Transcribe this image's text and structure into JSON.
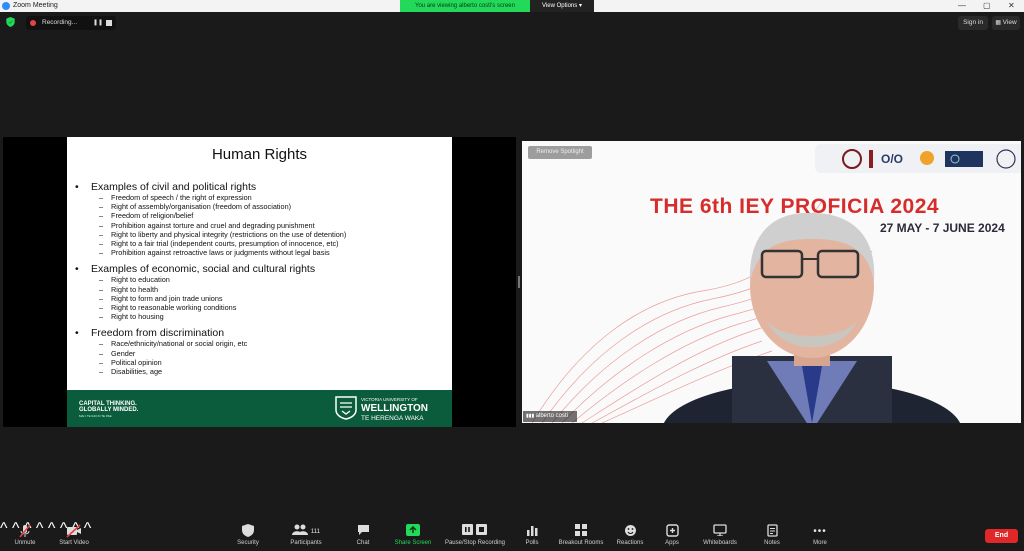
{
  "window": {
    "title": "Zoom Meeting",
    "controls": [
      "—",
      "▢",
      "✕"
    ]
  },
  "banner": {
    "share_text": "You are viewing alberto costi's screen",
    "view_options": "View Options"
  },
  "recording": {
    "label": "Recording..."
  },
  "top_right": {
    "sign_in": "Sign in",
    "view": "View"
  },
  "slide": {
    "title": "Human Rights",
    "sections": [
      {
        "heading": "Examples of civil and political rights",
        "items": [
          "Freedom of speech / the right of expression",
          "Right of assembly/organisation (freedom of association)",
          "Freedom of religion/belief",
          "Prohibition against torture and cruel and degrading punishment",
          "Right to liberty and physical integrity (restrictions on the use of detention)",
          "Right to a fair trial (independent courts, presumption of innocence, etc)",
          "Prohibition against retroactive laws or judgments without legal basis"
        ]
      },
      {
        "heading": "Examples of economic, social and cultural rights",
        "items": [
          "Right to education",
          "Right to health",
          "Right to form and join trade unions",
          "Right to reasonable working conditions",
          "Right to housing"
        ]
      },
      {
        "heading": "Freedom from discrimination",
        "items": [
          "Race/ethnicity/national or social origin, etc",
          "Gender",
          "Political opinion",
          "Disabilities, age"
        ]
      }
    ],
    "footer": {
      "tagline_1": "CAPITAL THINKING.",
      "tagline_2": "GLOBALLY MINDED.",
      "tagline_3": "MAI I TE IHO KI TE PAE",
      "uni_small": "VICTORIA UNIVERSITY OF",
      "uni_big": "WELLINGTON",
      "uni_maori": "TE HERENGA WAKA"
    }
  },
  "video": {
    "remove_spotlight": "Remove Spotlight",
    "event_title": "THE 6th IEY PROFICIA 2024",
    "event_dates": "27 MAY - 7 JUNE 2024",
    "participant_name": "alberto costi"
  },
  "toolbar": {
    "items": [
      {
        "id": "unmute",
        "label": "Unmute",
        "icon": "mic-muted-icon"
      },
      {
        "id": "start-video",
        "label": "Start Video",
        "icon": "video-off-icon"
      },
      {
        "id": "security",
        "label": "Security",
        "icon": "shield-icon"
      },
      {
        "id": "participants",
        "label": "Participants",
        "icon": "participants-icon",
        "count": "111"
      },
      {
        "id": "chat",
        "label": "Chat",
        "icon": "chat-icon"
      },
      {
        "id": "share-screen",
        "label": "Share Screen",
        "icon": "share-screen-icon"
      },
      {
        "id": "pause-stop-recording",
        "label": "Pause/Stop Recording",
        "icon": "recording-icon"
      },
      {
        "id": "polls",
        "label": "Polls",
        "icon": "polls-icon"
      },
      {
        "id": "breakout-rooms",
        "label": "Breakout Rooms",
        "icon": "breakout-rooms-icon"
      },
      {
        "id": "reactions",
        "label": "Reactions",
        "icon": "reactions-icon"
      },
      {
        "id": "apps",
        "label": "Apps",
        "icon": "apps-icon"
      },
      {
        "id": "whiteboards",
        "label": "Whiteboards",
        "icon": "whiteboard-icon"
      },
      {
        "id": "notes",
        "label": "Notes",
        "icon": "notes-icon"
      },
      {
        "id": "more",
        "label": "More",
        "icon": "more-icon"
      }
    ],
    "end_label": "End"
  },
  "colors": {
    "share_banner": "#23d959",
    "slide_footer": "#0b5b3d",
    "end_button": "#e02828",
    "event_red": "#d72c2c",
    "share_icon_green": "#23d959"
  }
}
